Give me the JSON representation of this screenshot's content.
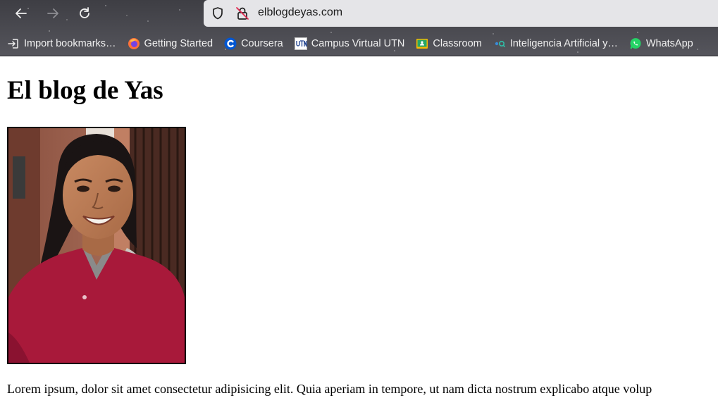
{
  "browser": {
    "url": "elblogdeyas.com",
    "nav": {
      "back_icon": "arrow-left-icon",
      "forward_icon": "arrow-right-icon",
      "reload_icon": "reload-icon"
    },
    "bookmarks": [
      {
        "label": "Import bookmarks…",
        "icon": "import-icon"
      },
      {
        "label": "Getting Started",
        "icon": "firefox-icon"
      },
      {
        "label": "Coursera",
        "icon": "coursera-icon"
      },
      {
        "label": "Campus Virtual UTN",
        "icon": "utn-icon"
      },
      {
        "label": "Classroom",
        "icon": "classroom-icon"
      },
      {
        "label": "Inteligencia Artificial y…",
        "icon": "ia-icon"
      },
      {
        "label": "WhatsApp",
        "icon": "whatsapp-icon"
      }
    ]
  },
  "page": {
    "title": "El blog de Yas",
    "paragraph": "Lorem ipsum, dolor sit amet consectetur adipisicing elit. Quia aperiam in tempore, ut nam dicta nostrum explicabo atque volup"
  }
}
